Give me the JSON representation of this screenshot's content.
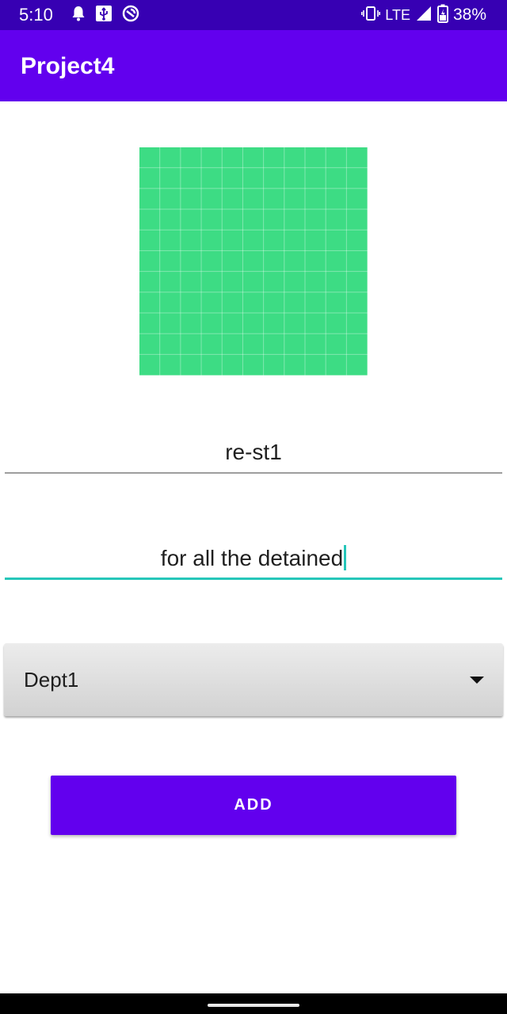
{
  "status_bar": {
    "time": "5:10",
    "network": "LTE",
    "battery": "38%",
    "icons_left": [
      "notification-bell-icon",
      "usb-icon",
      "sync-icon"
    ],
    "icons_right": [
      "vibrate-icon",
      "signal-icon",
      "battery-icon"
    ]
  },
  "app_bar": {
    "title": "Project4",
    "color": "#6200ee"
  },
  "image": {
    "description_icon": "green-grid-placeholder-icon",
    "color": "#3ddc84"
  },
  "form": {
    "name_value": "re-st1",
    "description_value": "for all the detained",
    "department_selected": "Dept1",
    "add_label": "ADD"
  },
  "colors": {
    "status_bar": "#3700b3",
    "primary": "#6200ee",
    "accent": "#26c6b9"
  }
}
